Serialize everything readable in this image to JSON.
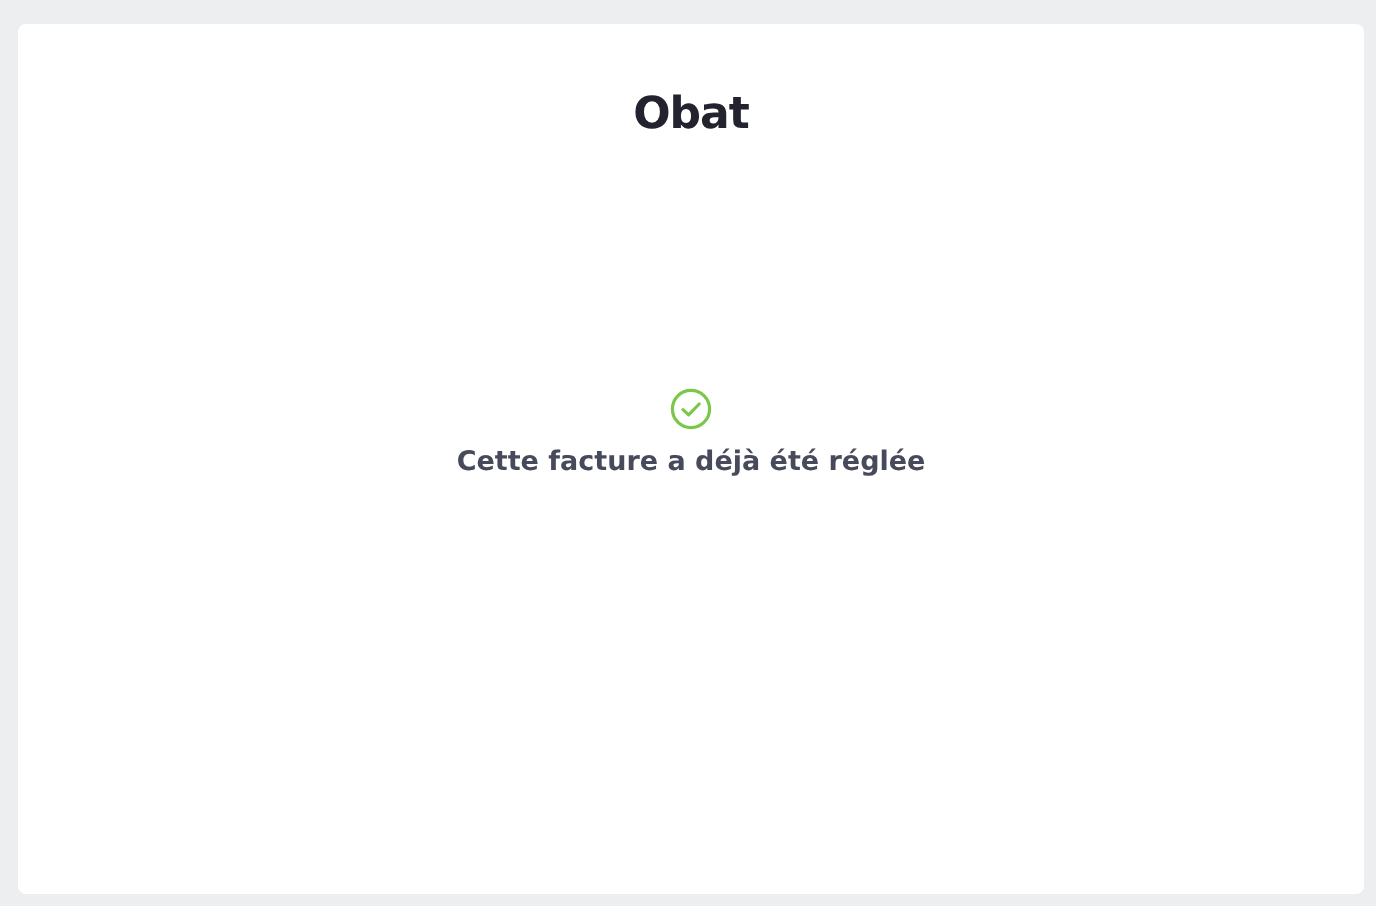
{
  "logo": "Obat",
  "message": "Cette facture a déjà été réglée"
}
